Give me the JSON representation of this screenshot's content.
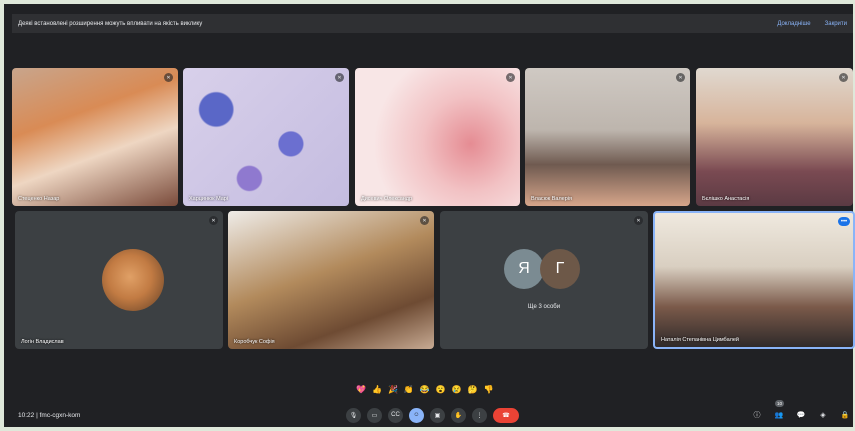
{
  "banner": {
    "message": "Деякі встановлені розширення можуть впливати на якість виклику",
    "details": "Докладніше",
    "close": "Закрити"
  },
  "participants": [
    {
      "name": "Стеценко Назар"
    },
    {
      "name": "Харцинюк Марі"
    },
    {
      "name": "Дисевич Олександр"
    },
    {
      "name": "Власюк Валерія"
    },
    {
      "name": "Бєлішко Анастасія"
    },
    {
      "name": "Логін Владислав"
    },
    {
      "name": "Коробчук Софія"
    },
    {
      "name": "",
      "avatars": [
        "Я",
        "Г"
      ],
      "others": "Ще 3 особи"
    },
    {
      "name": "Наталія Степанівна Цимбалей"
    }
  ],
  "reactions": [
    "💖",
    "👍",
    "🎉",
    "👏",
    "😂",
    "😮",
    "😢",
    "🤔",
    "👎"
  ],
  "footer": {
    "time": "10:22",
    "separator": "|",
    "meeting_code": "fmc-cgxn-kom",
    "people_count": "10"
  }
}
